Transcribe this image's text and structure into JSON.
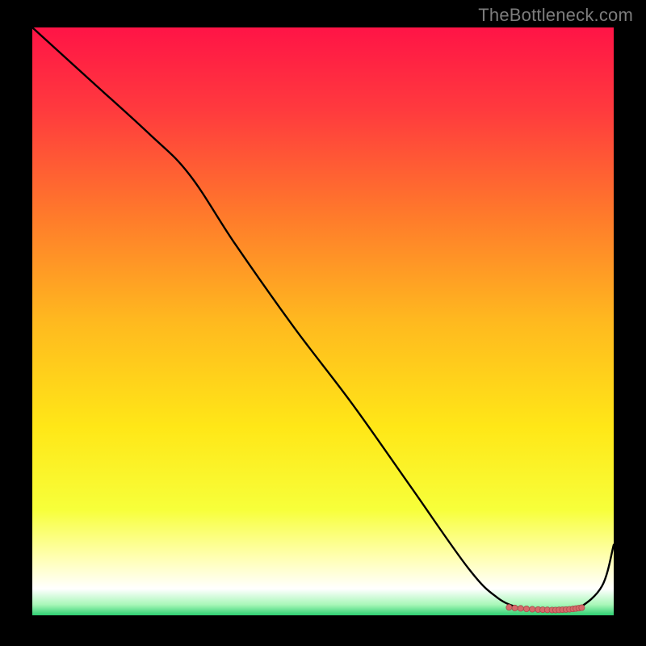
{
  "watermark": "TheBottleneck.com",
  "colors": {
    "gradient_stops": [
      {
        "offset": 0.0,
        "color": "#ff1446"
      },
      {
        "offset": 0.14,
        "color": "#ff3a3e"
      },
      {
        "offset": 0.32,
        "color": "#ff7a2b"
      },
      {
        "offset": 0.5,
        "color": "#ffb91f"
      },
      {
        "offset": 0.68,
        "color": "#ffe717"
      },
      {
        "offset": 0.82,
        "color": "#f7ff3a"
      },
      {
        "offset": 0.9,
        "color": "#ffffb0"
      },
      {
        "offset": 0.955,
        "color": "#ffffff"
      },
      {
        "offset": 0.982,
        "color": "#a8f7b8"
      },
      {
        "offset": 1.0,
        "color": "#2ecf72"
      }
    ],
    "line": "#000000",
    "dot_fill": "#d66a6a",
    "dot_stroke": "#a84a4a"
  },
  "chart_data": {
    "type": "line",
    "title": "",
    "xlabel": "",
    "ylabel": "",
    "xlim": [
      0,
      100
    ],
    "ylim": [
      0,
      100
    ],
    "grid": false,
    "legend": false,
    "series": [
      {
        "name": "curve",
        "x": [
          0,
          10,
          20,
          27,
          35,
          45,
          55,
          65,
          75,
          80,
          84,
          86,
          88,
          90,
          92,
          94,
          98,
          100
        ],
        "y": [
          100,
          91,
          82,
          75,
          63,
          49,
          36,
          22,
          8,
          3,
          1.2,
          1.0,
          0.9,
          0.9,
          1.0,
          1.2,
          5,
          12
        ]
      }
    ],
    "dots": {
      "series": "curve",
      "count": 18,
      "x_range": [
        82,
        94.5
      ],
      "cluster": [
        [
          82.0,
          1.35
        ],
        [
          83.0,
          1.25
        ],
        [
          84.0,
          1.18
        ],
        [
          85.0,
          1.1
        ],
        [
          86.0,
          1.03
        ],
        [
          87.0,
          0.98
        ],
        [
          87.8,
          0.95
        ],
        [
          88.6,
          0.92
        ],
        [
          89.4,
          0.9
        ],
        [
          90.0,
          0.9
        ],
        [
          90.6,
          0.92
        ],
        [
          91.2,
          0.95
        ],
        [
          91.8,
          0.98
        ],
        [
          92.4,
          1.02
        ],
        [
          93.0,
          1.08
        ],
        [
          93.5,
          1.15
        ],
        [
          94.0,
          1.22
        ],
        [
          94.5,
          1.3
        ]
      ]
    }
  }
}
